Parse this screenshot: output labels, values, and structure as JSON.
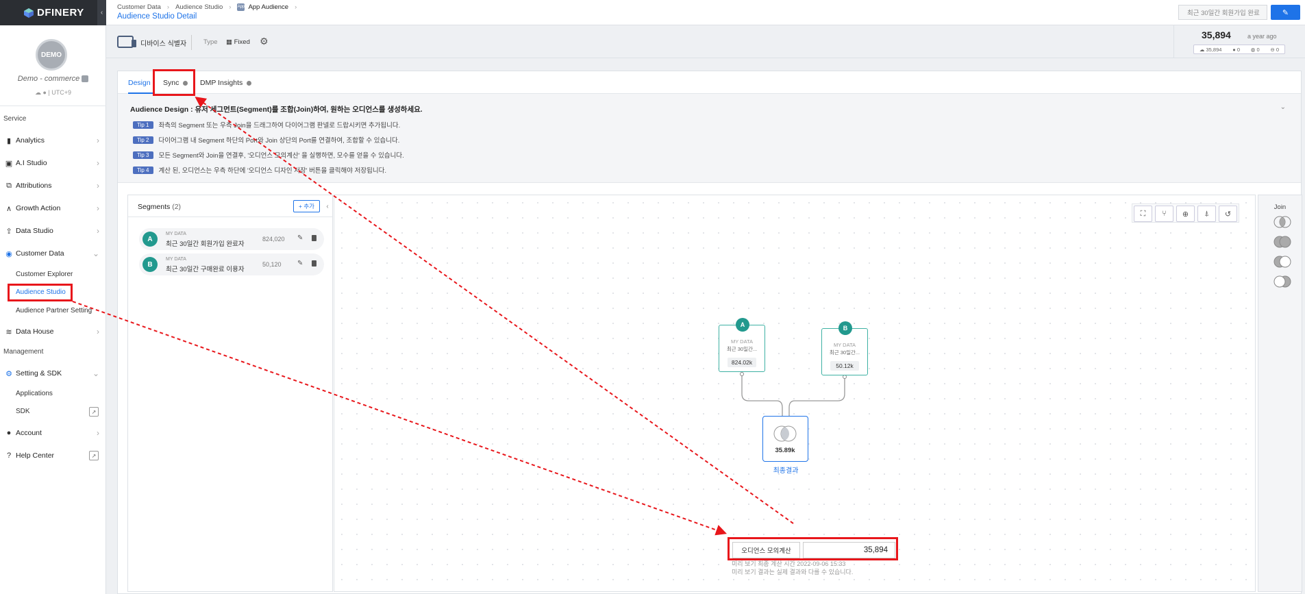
{
  "brand": {
    "name": "DFINERY",
    "accent": "#1e73e8",
    "highlight": "#e8161b"
  },
  "profile": {
    "avatar_text": "DEMO",
    "company": "Demo - commerce",
    "timezone": "| UTC+9"
  },
  "sidebar": {
    "service_title": "Service",
    "items": [
      {
        "label": "Analytics",
        "icon": "bar-chart-icon"
      },
      {
        "label": "A.I Studio",
        "icon": "ai-icon"
      },
      {
        "label": "Attributions",
        "icon": "attribution-icon"
      },
      {
        "label": "Growth Action",
        "icon": "growth-icon"
      },
      {
        "label": "Data Studio",
        "icon": "upload-icon"
      },
      {
        "label": "Customer Data",
        "icon": "target-icon"
      }
    ],
    "customer_sub": [
      "Customer Explorer",
      "Audience Studio",
      "Audience Partner Setting"
    ],
    "data_house": "Data House",
    "management_title": "Management",
    "setting": "Setting & SDK",
    "setting_sub": [
      "Applications",
      "SDK"
    ],
    "account": "Account",
    "help": "Help Center"
  },
  "topbar": {
    "crumbs": [
      "Customer Data",
      "Audience Studio",
      "App Audience"
    ],
    "app_icon_text": "App",
    "title": "Audience Studio Detail",
    "select_value": "최근 30일간 회원가입 완료"
  },
  "infobar": {
    "device_label": "디바이스 식별자",
    "type_label": "Type",
    "type_value": "Fixed",
    "count": "35,894",
    "count_ago": "a year ago",
    "mini": [
      "35,894",
      "0",
      "0",
      "0"
    ]
  },
  "tabs": [
    "Design",
    "Sync",
    "DMP Insights"
  ],
  "design": {
    "title": "Audience Design : 유저 세그먼트(Segment)를 조합(Join)하여, 원하는 오디언스를 생성하세요.",
    "tips": [
      {
        "badge": "Tip 1",
        "text": "좌측의 Segment 또는 우측 Join을 드래그하여 다이어그램 판넬로 드랍시키면 추가됩니다."
      },
      {
        "badge": "Tip 2",
        "text": "다이어그램 내 Segment 하단의 Port와 Join 상단의 Port를 연결하여, 조합할 수 있습니다."
      },
      {
        "badge": "Tip 3",
        "text": "모든 Segment와 Join을 연결후, '오디언스 모의계산' 을 실행하면, 모수를 얻을 수 있습니다."
      },
      {
        "badge": "Tip 4",
        "text": "계산 된, 오디언스는 우측 하단에 '오디언스 디자인 저장' 버튼을 클릭해야 저장됩니다."
      }
    ]
  },
  "segments": {
    "title": "Segments",
    "count": "(2)",
    "add_label": "+ 추가",
    "items": [
      {
        "badge": "A",
        "source": "MY DATA",
        "name": "최근 30일간 회원가입 완료자",
        "value": "824,020"
      },
      {
        "badge": "B",
        "source": "MY DATA",
        "name": "최근 30일간 구매완료 이용자",
        "value": "50,120"
      }
    ]
  },
  "diagram": {
    "nodes": [
      {
        "badge": "A",
        "source": "MY DATA",
        "name": "최근 30일간...",
        "value": "824.02k"
      },
      {
        "badge": "B",
        "source": "MY DATA",
        "name": "최근 30일간...",
        "value": "50.12k"
      }
    ],
    "result_value": "35.89k",
    "result_label": "최종결과"
  },
  "join": {
    "title": "Join",
    "types": [
      "intersection-join-icon",
      "union-join-icon",
      "left-exclude-join-icon",
      "right-exclude-join-icon"
    ]
  },
  "calc": {
    "button": "오디언스 모의계산",
    "value": "35,894",
    "note1": "미리 보기 최종 계산 시간 2022-09-06 15:33",
    "note2": "미리 보기 결과는 실제 결과와 다를 수 있습니다."
  }
}
